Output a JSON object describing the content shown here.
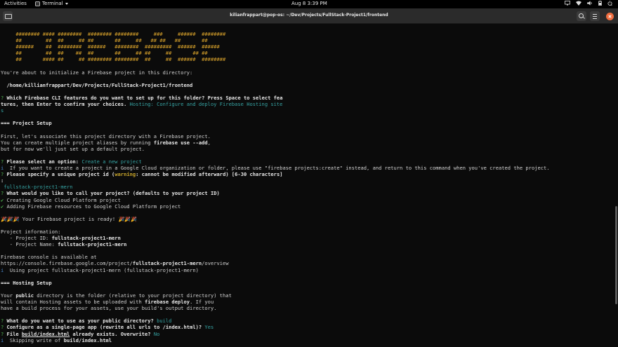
{
  "topbar": {
    "activities": "Activities",
    "app_name": "Terminal",
    "clock": "Aug 8  3:39 PM",
    "system_icons": [
      "display-icon",
      "wifi-icon",
      "volume-icon",
      "battery-icon",
      "power-icon"
    ]
  },
  "window": {
    "title": "kilianfrappart@pop-os: ~/Dev/Projects/FullStack-Project1/frontend"
  },
  "terminal": {
    "art": [
      "     ######## #### ########  ######## ########     ###     ######  ########",
      "     ##        ##  ##     ## ##       ##     ##   ## ##   ##       ##",
      "     ######    ##  ########  ######   ########  #########  ######  ######",
      "     ##        ##  ##    ##  ##       ##     ## ##     ##       ## ##",
      "     ##       #### ##     ## ######## ########  ##     ##  ######  ########"
    ],
    "intro": "You're about to initialize a Firebase project in this directory:",
    "directory": "  /home/killianfrappart/Dev/Projects/FullStack-Project1/frontend",
    "q1_mark": "?",
    "q1_text_a": " Which Firebase CLI features do you want to set up for this folder? Press Space to select fea",
    "q1_text_b": "tures, then Enter to confirm your choices.",
    "q1_answer": " Hosting: Configure and deploy Firebase Hosting site",
    "q1_tail": "s",
    "project_setup_header": "=== Project Setup",
    "ps_line1": "First, let's associate this project directory with a Firebase project.",
    "ps_line2_a": "You can create multiple project aliases by running ",
    "ps_line2_cmd": "firebase use --add",
    "ps_line2_b": ",",
    "ps_line3": "but for now we'll just set up a default project.",
    "q2_mark": "?",
    "q2_text": " Please select an option:",
    "q2_answer": " Create a new project",
    "info_mark": "i",
    "info_text": "  If you want to create a project in a Google Cloud organization or folder, please use \"firebase projects:create\" instead, and return to this command when you've created the project.",
    "q3_mark": "?",
    "q3_text_a": " Please specify a unique project id (",
    "q3_warning": "warning",
    "q3_text_b": ": cannot be modified afterward) [6-30 characters]",
    "q3_colon": ":",
    "q3_answer": " fullstack-project1-mern",
    "q4_mark": "?",
    "q4_text": " What would you like to call your project? (defaults to your project ID)",
    "check_mark": "✔",
    "done1": " Creating Google Cloud Platform project",
    "done2": " Adding Firebase resources to Google Cloud Platform project",
    "ready_emoji_a": "🎉🎉🎉",
    "ready_text": " Your Firebase project is ready! ",
    "ready_emoji_b": "🎉🎉🎉",
    "proj_info": "Project information:",
    "proj_id_label": "   - Project ID: ",
    "proj_id": "fullstack-project1-mern",
    "proj_name_label": "   - Project Name: ",
    "proj_name": "fullstack-project1-mern",
    "console_line": "Firebase console is available at",
    "console_url_a": "https://console.firebase.google.com/project/",
    "console_url_b": "fullstack-project1-mern",
    "console_url_c": "/overview",
    "using_mark": "i",
    "using_text": "  Using project fullstack-project1-mern (fullstack-project1-mern)",
    "hosting_header": "=== Hosting Setup",
    "hs_a1": "Your ",
    "hs_a_bold": "public",
    "hs_a2": " directory is the folder (relative to your project directory) that",
    "hs_b1": "will contain Hosting assets to be uploaded with ",
    "hs_b_cmd": "firebase deploy",
    "hs_b2": ". If you",
    "hs_c": "have a build process for your assets, use your build's output directory.",
    "q5_mark": "?",
    "q5_text": " What do you want to use as your public directory?",
    "q5_answer": " build",
    "q6_mark": "?",
    "q6_text": " Configure as a single-page app (rewrite all urls to /index.html)?",
    "q6_answer": " Yes",
    "q7_mark": "?",
    "q7_text_a": " File ",
    "q7_file": "build/index.html",
    "q7_text_b": " already exists. Overwrite?",
    "q7_answer": " No",
    "skip_mark": "i",
    "skip_text_a": "  Skipping write of ",
    "skip_file": "build/index.html"
  }
}
